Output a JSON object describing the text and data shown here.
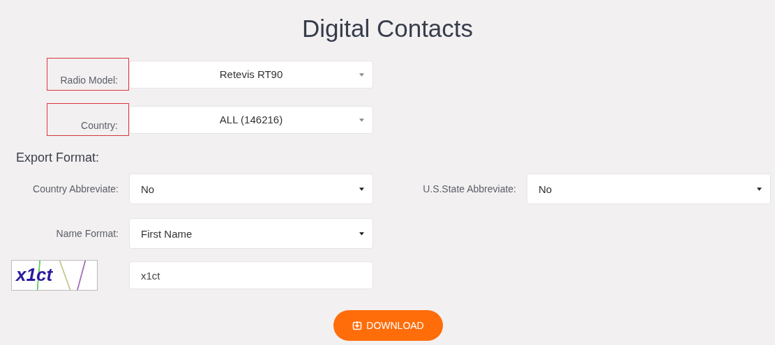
{
  "title": "Digital Contacts",
  "selectors": [
    {
      "label": "Radio Model:",
      "value": "Retevis RT90",
      "highlighted": true
    },
    {
      "label": "Country:",
      "value": "ALL (146216)",
      "highlighted": true
    }
  ],
  "export_format": {
    "heading": "Export Format:",
    "rows": [
      [
        {
          "label": "Country Abbreviate:",
          "value": "No"
        },
        {
          "label": "U.S.State Abbreviate:",
          "value": "No"
        }
      ],
      [
        {
          "label": "Name Format:",
          "value": "First Name"
        }
      ]
    ]
  },
  "captcha": {
    "image_text": "x1ct",
    "value": "x1ct"
  },
  "download_button": {
    "label": "DOWNLOAD"
  }
}
